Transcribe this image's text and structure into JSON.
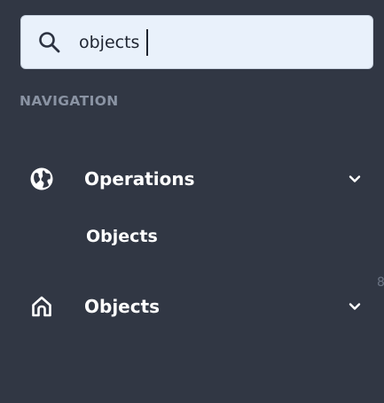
{
  "search": {
    "value": "objects",
    "icon": "search-icon"
  },
  "sidebar": {
    "section_label": "NAVIGATION",
    "items": [
      {
        "label": "Operations",
        "icon": "globe-icon",
        "expanded": true,
        "children": [
          {
            "label": "Objects"
          }
        ]
      },
      {
        "label": "Objects",
        "icon": "home-icon",
        "expanded": false,
        "children": []
      }
    ]
  },
  "colors": {
    "background": "#313744",
    "search_background": "#e9f1fb",
    "section_label": "#8a93a3",
    "nav_text": "#ffffff"
  }
}
